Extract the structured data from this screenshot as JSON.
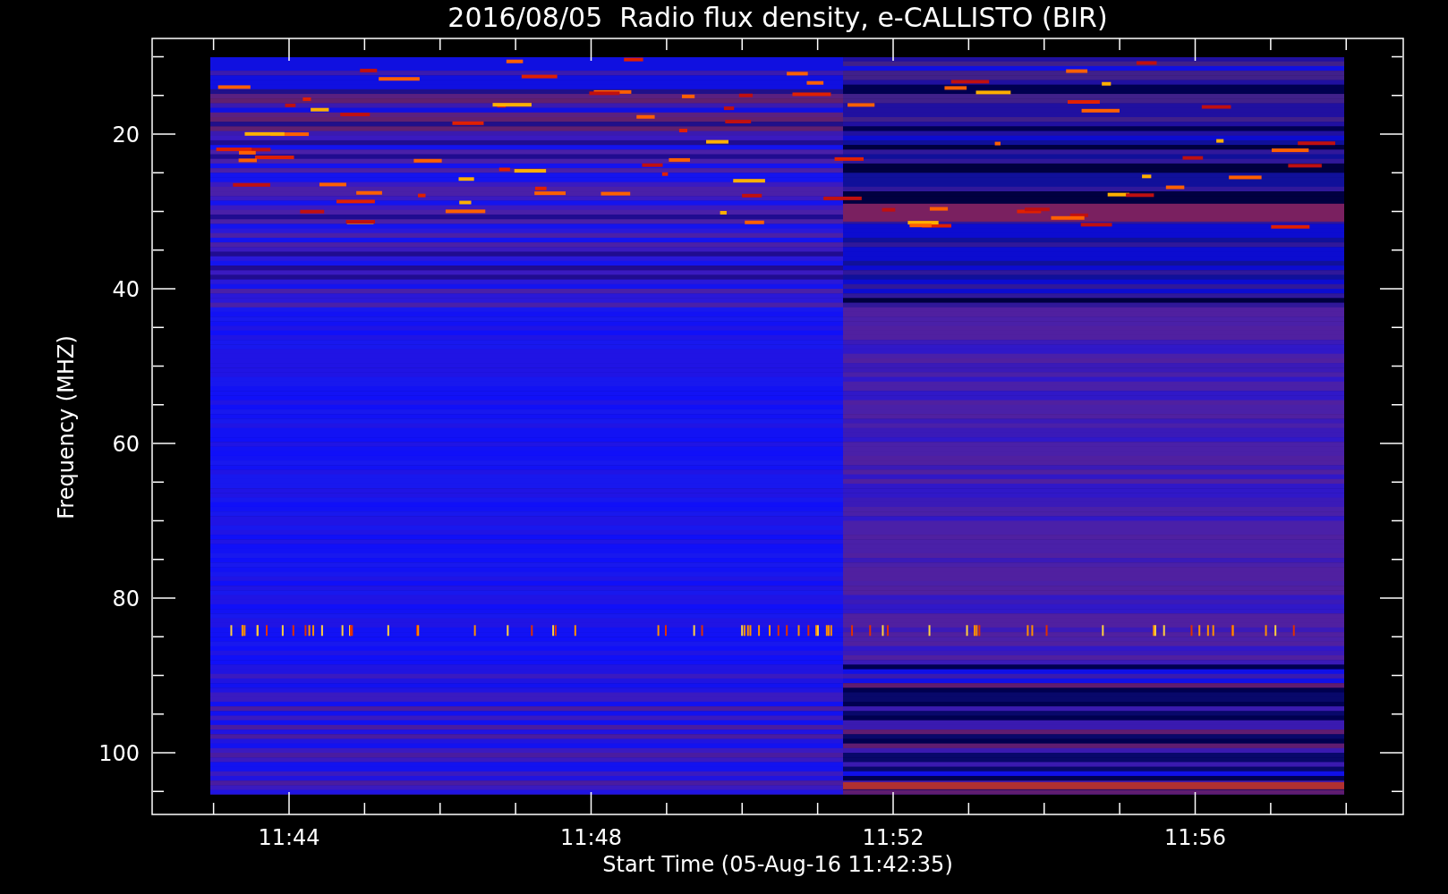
{
  "title": "2016/08/05  Radio flux density, e-CALLISTO (BIR)",
  "y_axis": {
    "label": "Frequency (MHZ)",
    "ticks": [
      "20",
      "40",
      "60",
      "80",
      "100"
    ]
  },
  "x_axis": {
    "label": "Start Time (05-Aug-16 11:42:35)",
    "ticks": [
      "11:44",
      "11:48",
      "11:52",
      "11:56"
    ]
  }
}
